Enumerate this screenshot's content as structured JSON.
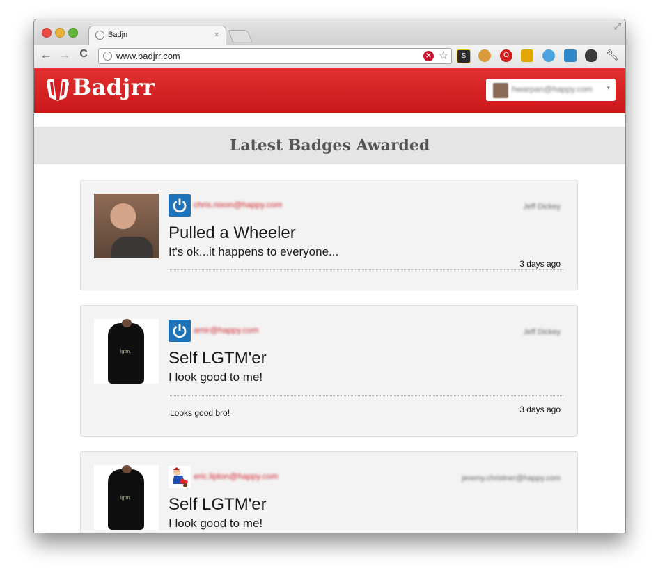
{
  "browser": {
    "tab_title": "Badjrr",
    "tab_close": "×",
    "url": "www.badjrr.com",
    "nav": {
      "back": "←",
      "forward": "→",
      "reload": "C"
    },
    "resize": "⤢"
  },
  "site": {
    "logo_text": "Badjrr",
    "brand_color": "#d41f24",
    "user_email": "hwarpan@happy.com",
    "user_caret": "▾"
  },
  "page": {
    "section_title": "Latest Badges Awarded"
  },
  "awards": [
    {
      "recipient": "chris.nixon@happy.com",
      "awarder": "Jeff Dickey",
      "badge_name": "Pulled a Wheeler",
      "badge_description": "It's ok...it happens to everyone...",
      "timestamp": "3 days ago",
      "badge_icon": "power-icon"
    },
    {
      "recipient": "amir@happy.com",
      "awarder": "Jeff Dickey",
      "badge_name": "Self LGTM'er",
      "badge_description": "I look good to me!",
      "comment": "Looks good bro!",
      "timestamp": "3 days ago",
      "badge_icon": "power-icon",
      "shirt_text": "lgtm."
    },
    {
      "recipient": "eric.lipton@happy.com",
      "awarder": "jeremy.christner@happy.com",
      "badge_name": "Self LGTM'er",
      "badge_description": "I look good to me!",
      "badge_icon": "cartoon-icon",
      "shirt_text": "lgtm."
    }
  ]
}
